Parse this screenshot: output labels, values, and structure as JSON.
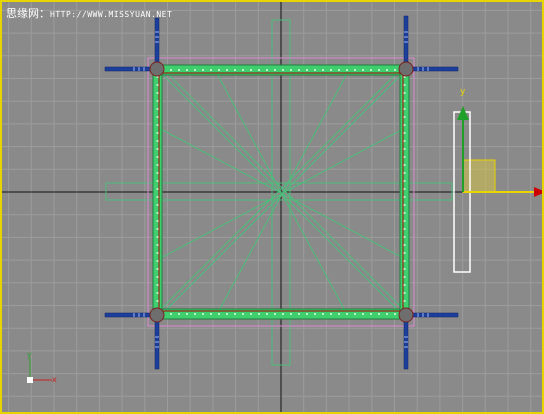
{
  "watermark": {
    "brand": "思缘网：",
    "site": "HTTP://WWW.MISSYUAN.NET"
  },
  "viewport": {
    "type": "3d-viewport-top",
    "border_color": "#e8d400",
    "background": "#8a8a8a",
    "grid_color": "#9c9c9c",
    "axis_color": "#111111"
  },
  "gizmo": {
    "y_label": "y",
    "x_color": "#e8d400",
    "y_color": "#1fa02a",
    "arrow_tip_color": "#cc0000",
    "plane_color": "#d4c24a"
  },
  "axis_tripod": {
    "y_label": "y",
    "x_label": "x",
    "y_color": "#2aa02a",
    "x_color": "#cc2222"
  },
  "objects": {
    "frame_color": "#3fcf6f",
    "selection_color": "#aa0000",
    "helper_color": "#4bbf7a",
    "pole_color": "#1c3f9e",
    "corner_color": "#6e6e6e"
  }
}
